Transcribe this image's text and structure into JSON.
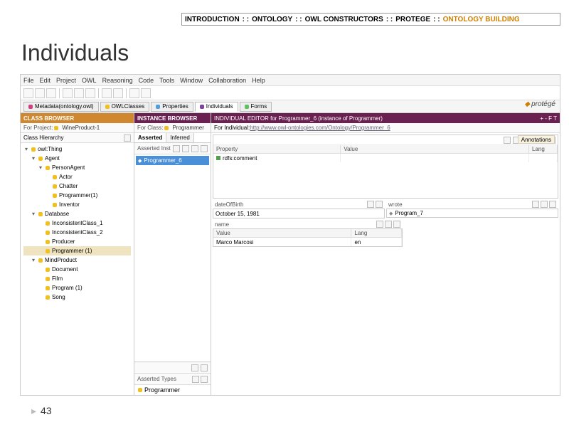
{
  "breadcrumb": {
    "items": [
      "INTRODUCTION",
      "ONTOLOGY",
      "OWL CONSTRUCTORS",
      "PROTEGE",
      "ONTOLOGY BUILDING"
    ],
    "sep": " : : "
  },
  "slide_title": "Individuals",
  "page_number": "43",
  "menubar": [
    "File",
    "Edit",
    "Project",
    "OWL",
    "Reasoning",
    "Code",
    "Tools",
    "Window",
    "Collaboration",
    "Help"
  ],
  "top_tabs": [
    {
      "label": "Metadata(ontology.owl)",
      "color": "#d04080"
    },
    {
      "label": "OWLClasses",
      "color": "#f0c020"
    },
    {
      "label": "Properties",
      "color": "#50a0e0"
    },
    {
      "label": "Individuals",
      "color": "#8040a0"
    },
    {
      "label": "Forms",
      "color": "#60c060"
    }
  ],
  "logo_text": "protégé",
  "class_browser": {
    "title": "CLASS BROWSER",
    "project_label": "For Project:",
    "project_value": "WineProduct-1",
    "section": "Class Hierarchy",
    "tree": [
      {
        "label": "owl:Thing",
        "indent": 0,
        "exp": "▾"
      },
      {
        "label": "Agent",
        "indent": 1,
        "exp": "▾"
      },
      {
        "label": "PersonAgent",
        "indent": 2,
        "exp": "▾"
      },
      {
        "label": "Actor",
        "indent": 3,
        "exp": ""
      },
      {
        "label": "Chatter",
        "indent": 3,
        "exp": ""
      },
      {
        "label": "Programmer(1)",
        "indent": 3,
        "exp": "",
        "sel": false
      },
      {
        "label": "Inventor",
        "indent": 3,
        "exp": ""
      },
      {
        "label": "Database",
        "indent": 1,
        "exp": "▾"
      },
      {
        "label": "InconsistentClass_1",
        "indent": 2,
        "exp": ""
      },
      {
        "label": "InconsistentClass_2",
        "indent": 2,
        "exp": ""
      },
      {
        "label": "Producer",
        "indent": 2,
        "exp": ""
      },
      {
        "label": "Programmer (1)",
        "indent": 2,
        "exp": "",
        "sel": true
      },
      {
        "label": "MindProduct",
        "indent": 1,
        "exp": "▾"
      },
      {
        "label": "Document",
        "indent": 2,
        "exp": ""
      },
      {
        "label": "Film",
        "indent": 2,
        "exp": ""
      },
      {
        "label": "Program (1)",
        "indent": 2,
        "exp": ""
      },
      {
        "label": "Song",
        "indent": 2,
        "exp": ""
      }
    ]
  },
  "instance_browser": {
    "title": "INSTANCE BROWSER",
    "class_label": "For Class:",
    "class_value": "Programmer",
    "tabs": [
      "Asserted",
      "Inferred"
    ],
    "section": "Asserted Inst",
    "items": [
      "Programmer_6"
    ],
    "types_section": "Asserted Types",
    "types": [
      "Programmer"
    ]
  },
  "editor": {
    "title": "INDIVIDUAL EDITOR for Programmer_6   (instance of Programmer)",
    "btns": "+ - F T",
    "ind_label": "For Individual:",
    "ind_uri": "http://www.owl-ontologies.com/Ontology/Programmer_6",
    "annotations_label": "Annotations",
    "prop_table": {
      "headers": [
        "Property",
        "Value",
        "Lang"
      ],
      "rows": [
        {
          "property": "rdfs:comment",
          "value": "",
          "lang": ""
        }
      ]
    },
    "dob": {
      "label": "dateOfBirth",
      "value": "October 15, 1981"
    },
    "wrote": {
      "label": "wrote",
      "items": [
        "Program_7"
      ]
    },
    "name_field": {
      "label": "name",
      "headers": [
        "Value",
        "Lang"
      ],
      "row": {
        "value": "Marco Marcosi",
        "lang": "en"
      }
    }
  }
}
